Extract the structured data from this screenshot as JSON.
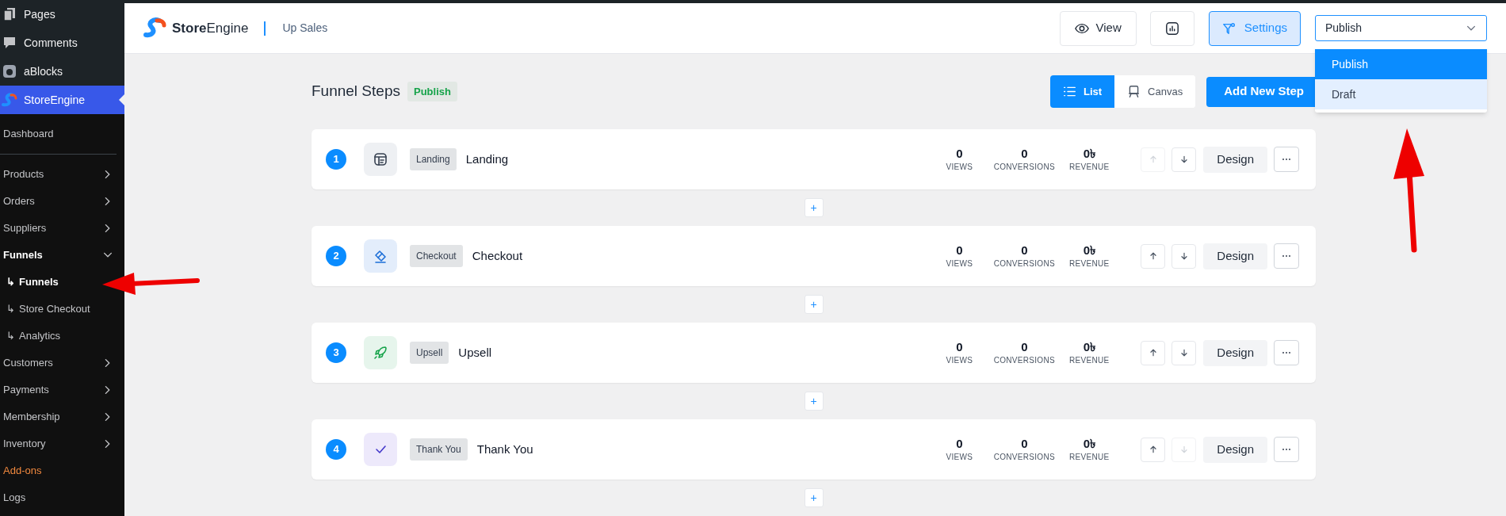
{
  "sidebar": {
    "top_items": [
      {
        "kind": "pages",
        "label": "Pages",
        "selected": false
      },
      {
        "kind": "comments",
        "label": "Comments",
        "selected": false
      },
      {
        "kind": "ablocks",
        "label": "aBlocks",
        "selected": false
      },
      {
        "kind": "storeengine",
        "label": "StoreEngine",
        "selected": true
      }
    ],
    "menu": [
      {
        "kind": "plain",
        "label": "Dashboard"
      },
      {
        "kind": "parent",
        "label": "Products",
        "expanded": false
      },
      {
        "kind": "parent",
        "label": "Orders",
        "expanded": false
      },
      {
        "kind": "parent",
        "label": "Suppliers",
        "expanded": false
      },
      {
        "kind": "parent",
        "label": "Funnels",
        "expanded": true,
        "children": [
          {
            "marker": "↳",
            "label": "Funnels",
            "selected": true
          },
          {
            "marker": "↳",
            "label": "Store Checkout",
            "selected": false
          },
          {
            "marker": "↳",
            "label": "Analytics",
            "selected": false
          }
        ]
      },
      {
        "kind": "parent",
        "label": "Customers",
        "expanded": false
      },
      {
        "kind": "parent",
        "label": "Payments",
        "expanded": false
      },
      {
        "kind": "parent",
        "label": "Membership",
        "expanded": false
      },
      {
        "kind": "parent",
        "label": "Inventory",
        "expanded": false
      },
      {
        "kind": "addon",
        "label": "Add-ons"
      },
      {
        "kind": "plain",
        "label": "Logs"
      }
    ]
  },
  "header": {
    "brand": "**Store**Engine",
    "breadcrumb": "Up Sales",
    "view_button": "View",
    "settings_button": {
      "label": "Settings",
      "active": true
    },
    "status_select": {
      "value": "Publish",
      "open": true,
      "options": [
        {
          "label": "Publish",
          "selected": true
        },
        {
          "label": "Draft",
          "selected": false
        }
      ]
    }
  },
  "page": {
    "title": "Funnel Steps",
    "status_badge": "Publish",
    "view_toggle": [
      {
        "label": "List",
        "selected": true
      },
      {
        "label": "Canvas",
        "selected": false
      }
    ],
    "add_button": "Add New Step"
  },
  "steps": [
    {
      "number": "1",
      "kind": "landing",
      "tag": "Landing",
      "name": "Landing",
      "stats": [
        {
          "value": "0",
          "label": "VIEWS"
        },
        {
          "value": "0",
          "label": "CONVERSIONS"
        },
        {
          "value": "0৳",
          "label": "REVENUE"
        }
      ],
      "up_disabled": true,
      "down_disabled": false,
      "design": "Design",
      "add_label": "+"
    },
    {
      "number": "2",
      "kind": "checkout",
      "tag": "Checkout",
      "name": "Checkout",
      "stats": [
        {
          "value": "0",
          "label": "VIEWS"
        },
        {
          "value": "0",
          "label": "CONVERSIONS"
        },
        {
          "value": "0৳",
          "label": "REVENUE"
        }
      ],
      "up_disabled": false,
      "down_disabled": false,
      "design": "Design",
      "add_label": "+"
    },
    {
      "number": "3",
      "kind": "upsell",
      "tag": "Upsell",
      "name": "Upsell",
      "stats": [
        {
          "value": "0",
          "label": "VIEWS"
        },
        {
          "value": "0",
          "label": "CONVERSIONS"
        },
        {
          "value": "0৳",
          "label": "REVENUE"
        }
      ],
      "up_disabled": false,
      "down_disabled": false,
      "design": "Design",
      "add_label": "+"
    },
    {
      "number": "4",
      "kind": "thankyou",
      "tag": "Thank You",
      "name": "Thank You",
      "stats": [
        {
          "value": "0",
          "label": "VIEWS"
        },
        {
          "value": "0",
          "label": "CONVERSIONS"
        },
        {
          "value": "0৳",
          "label": "REVENUE"
        }
      ],
      "up_disabled": false,
      "down_disabled": true,
      "design": "Design",
      "add_label": "+"
    }
  ]
}
